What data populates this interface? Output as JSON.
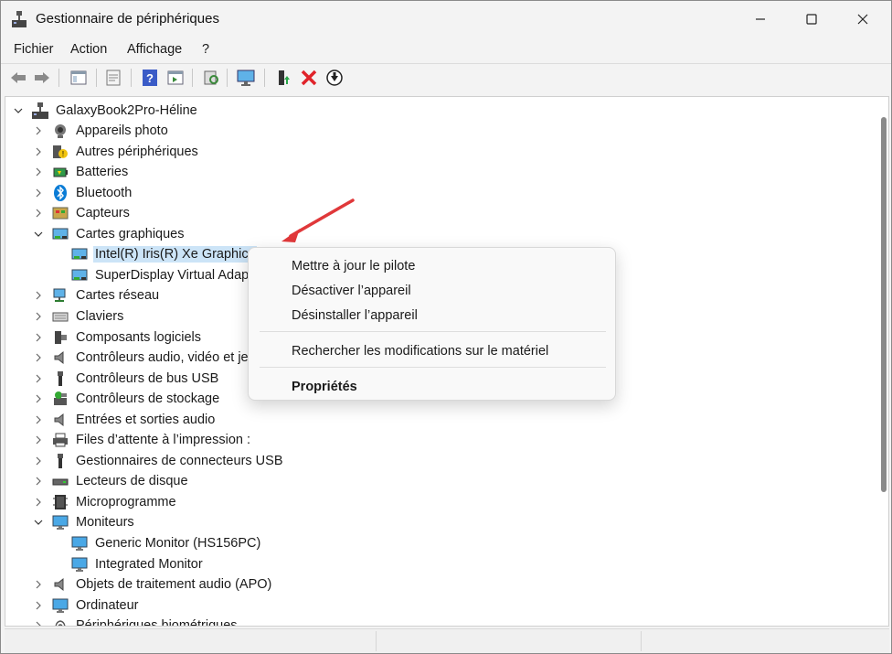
{
  "window": {
    "title": "Gestionnaire de périphériques"
  },
  "menu": [
    "Fichier",
    "Action",
    "Affichage",
    "?"
  ],
  "tree": {
    "root": "GalaxyBook2Pro-Héline",
    "items": [
      {
        "label": "Appareils photo",
        "icon": "camera-icon",
        "expanded": false
      },
      {
        "label": "Autres périphériques",
        "icon": "unknown-device-icon",
        "expanded": false
      },
      {
        "label": "Batteries",
        "icon": "battery-icon",
        "expanded": false
      },
      {
        "label": "Bluetooth",
        "icon": "bluetooth-icon",
        "expanded": false
      },
      {
        "label": "Capteurs",
        "icon": "sensor-icon",
        "expanded": false
      },
      {
        "label": "Cartes graphiques",
        "icon": "display-adapter-icon",
        "expanded": true
      },
      {
        "label": "Intel(R) Iris(R) Xe Graphics",
        "icon": "display-adapter-icon",
        "child": true,
        "selected": true
      },
      {
        "label": "SuperDisplay Virtual Adap",
        "icon": "display-adapter-icon",
        "child": true
      },
      {
        "label": "Cartes réseau",
        "icon": "network-icon",
        "expanded": false
      },
      {
        "label": "Claviers",
        "icon": "keyboard-icon",
        "expanded": false
      },
      {
        "label": "Composants logiciels",
        "icon": "software-component-icon",
        "expanded": false
      },
      {
        "label": "Contrôleurs audio, vidéo et je",
        "icon": "speaker-icon",
        "expanded": false
      },
      {
        "label": "Contrôleurs de bus USB",
        "icon": "usb-icon",
        "expanded": false
      },
      {
        "label": "Contrôleurs de stockage",
        "icon": "storage-controller-icon",
        "expanded": false
      },
      {
        "label": "Entrées et sorties audio",
        "icon": "speaker-icon",
        "expanded": false
      },
      {
        "label": "Files d’attente à l’impression :",
        "icon": "printer-icon",
        "expanded": false
      },
      {
        "label": "Gestionnaires de connecteurs USB",
        "icon": "usb-icon",
        "expanded": false
      },
      {
        "label": "Lecteurs de disque",
        "icon": "disk-drive-icon",
        "expanded": false
      },
      {
        "label": "Microprogramme",
        "icon": "firmware-icon",
        "expanded": false
      },
      {
        "label": "Moniteurs",
        "icon": "monitor-icon",
        "expanded": true
      },
      {
        "label": "Generic Monitor (HS156PC)",
        "icon": "monitor-icon",
        "child": true
      },
      {
        "label": "Integrated Monitor",
        "icon": "monitor-icon",
        "child": true
      },
      {
        "label": "Objets de traitement audio (APO)",
        "icon": "speaker-icon",
        "expanded": false
      },
      {
        "label": "Ordinateur",
        "icon": "monitor-icon",
        "expanded": false
      },
      {
        "label": "Périphériques biométriques",
        "icon": "fingerprint-icon",
        "expanded": false
      }
    ]
  },
  "context_menu": {
    "items": [
      "Mettre à jour le pilote",
      "Désactiver l’appareil",
      "Désinstaller l’appareil",
      "Rechercher les modifications sur le matériel",
      "Propriétés"
    ]
  },
  "colors": {
    "selection": "#cce4f7",
    "accent": "#0078d4",
    "annotation_arrow": "#e0383a"
  }
}
